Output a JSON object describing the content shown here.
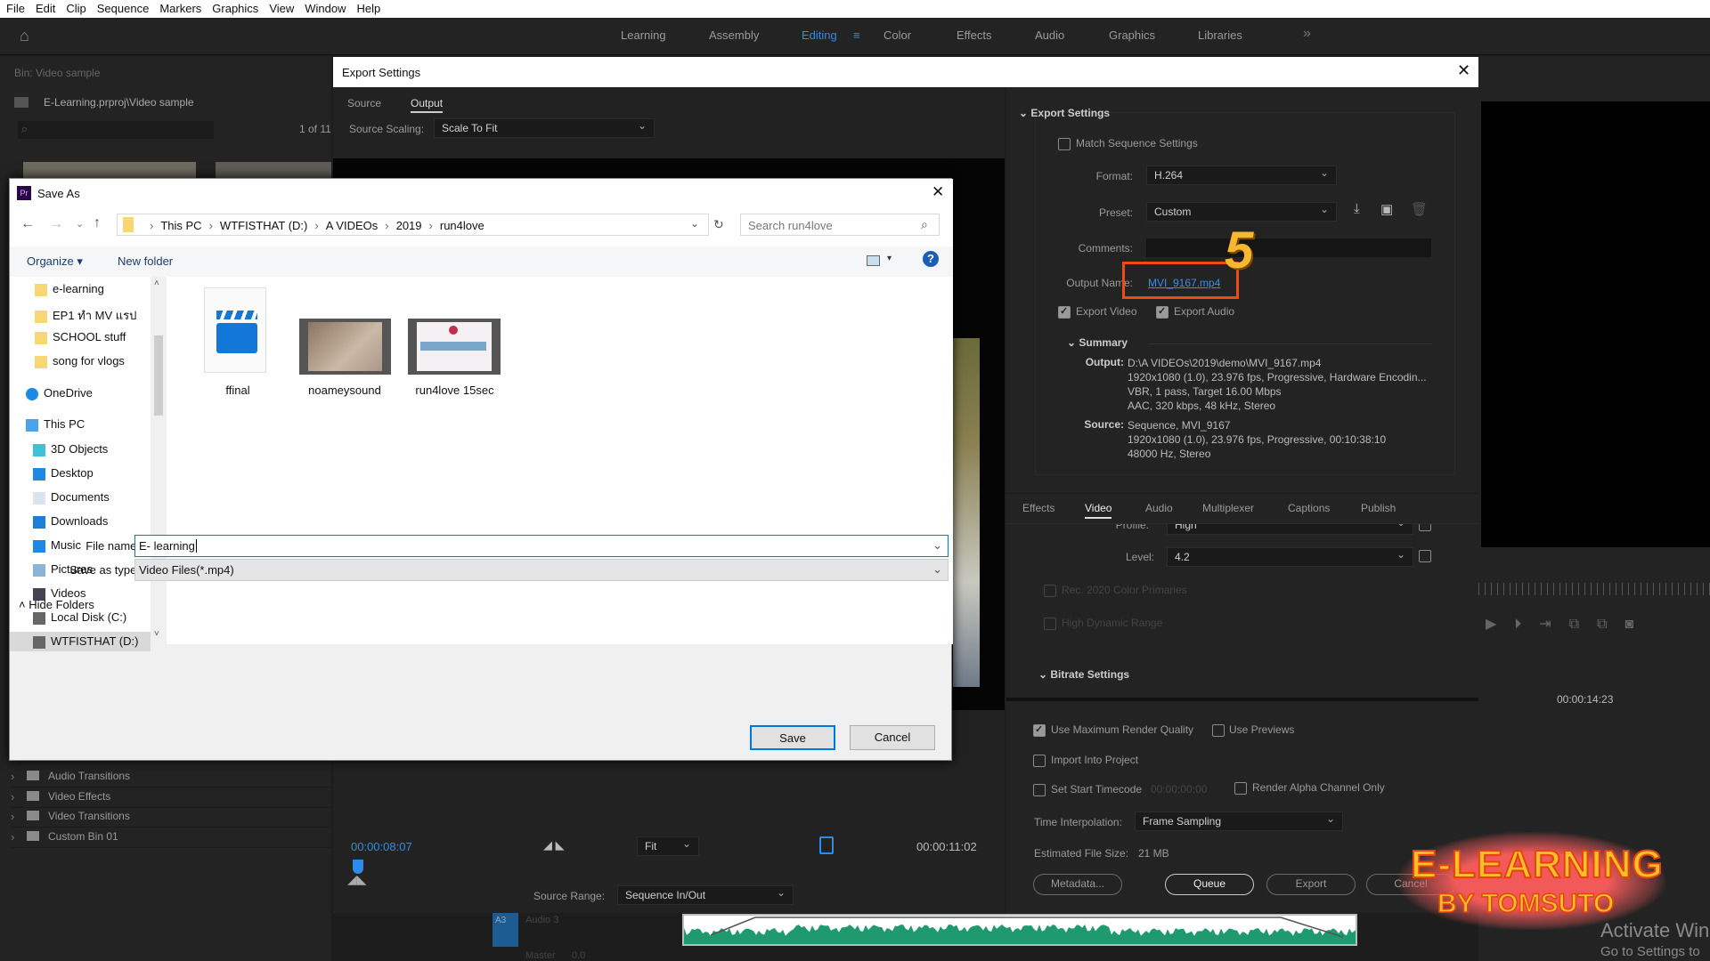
{
  "menu": [
    "File",
    "Edit",
    "Clip",
    "Sequence",
    "Markers",
    "Graphics",
    "View",
    "Window",
    "Help"
  ],
  "workspaces": [
    {
      "label": "Learning"
    },
    {
      "label": "Assembly"
    },
    {
      "label": "Editing",
      "active": true
    },
    {
      "label": "Color"
    },
    {
      "label": "Effects"
    },
    {
      "label": "Audio"
    },
    {
      "label": "Graphics"
    },
    {
      "label": "Libraries"
    }
  ],
  "accent": "#2d8ceb",
  "project": {
    "bin": "Bin: Video sample",
    "path": "E-Learning.prproj\\Video sample",
    "count": "1 of 11",
    "effects": [
      "Audio Transitions",
      "Video Effects",
      "Video Transitions",
      "Custom Bin 01"
    ]
  },
  "export": {
    "title": "Export Settings",
    "tabs": [
      "Source",
      "Output"
    ],
    "source_scaling_label": "Source Scaling:",
    "source_scaling": "Scale To Fit",
    "section": "Export Settings",
    "match_seq": "Match Sequence Settings",
    "format_label": "Format:",
    "format": "H.264",
    "preset_label": "Preset:",
    "preset": "Custom",
    "comments_label": "Comments:",
    "output_name_label": "Output Name:",
    "output_name": "MVI_9167.mp4",
    "annotation_number": "5",
    "export_video": "Export Video",
    "export_audio": "Export Audio",
    "summary": "Summary",
    "output_label": "Output:",
    "output_lines": [
      "D:\\A VIDEOs\\2019\\demo\\MVI_9167.mp4",
      "1920x1080 (1.0), 23.976 fps, Progressive, Hardware Encodin...",
      "VBR, 1 pass, Target 16.00 Mbps",
      "AAC, 320 kbps, 48 kHz, Stereo"
    ],
    "source_label": "Source:",
    "source_lines": [
      "Sequence, MVI_9167",
      "1920x1080 (1.0), 23.976 fps, Progressive, 00:10:38:10",
      "48000 Hz, Stereo"
    ],
    "settings_tabs": [
      "Effects",
      "Video",
      "Audio",
      "Multiplexer",
      "Captions",
      "Publish"
    ],
    "active_settings_tab": "Video",
    "profile_label": "Profile:",
    "profile": "High",
    "level_label": "Level:",
    "level": "4.2",
    "rec2020": "Rec. 2020 Color Primaries",
    "hdr": "High Dynamic Range",
    "bitrate": "Bitrate Settings",
    "max_quality": "Use Maximum Render Quality",
    "use_previews": "Use Previews",
    "import_project": "Import Into Project",
    "start_tc": "Set Start Timecode",
    "start_tc_value": "00:00:00:00",
    "alpha": "Render Alpha Channel Only",
    "interp_label": "Time Interpolation:",
    "interp": "Frame Sampling",
    "filesize_label": "Estimated File Size:",
    "filesize": "21 MB",
    "buttons": [
      "Metadata...",
      "Queue",
      "Export",
      "Cancel"
    ],
    "current_tc": "00:00:08:07",
    "fit": "Fit",
    "duration_tc": "00:00:11:02",
    "range_label": "Source Range:",
    "range": "Sequence In/Out"
  },
  "timeline": {
    "track": "A3",
    "track_name": "Audio 3",
    "master": "Master",
    "master_val": "0.0",
    "waveform_color": "#1f9a6e"
  },
  "program": {
    "timecode": "00:00:14:23"
  },
  "saveas": {
    "title": "Save As",
    "crumbs": [
      "This PC",
      "WTFISTHAT (D:)",
      "A VIDEOs",
      "2019",
      "run4love"
    ],
    "search_placeholder": "Search run4love",
    "organize": "Organize",
    "new_folder": "New folder",
    "nav": [
      {
        "label": "e-learning",
        "icon": "folder"
      },
      {
        "label": "EP1 ทำ MV แรป",
        "icon": "folder"
      },
      {
        "label": "SCHOOL stuff",
        "icon": "folder"
      },
      {
        "label": "song for vlogs",
        "icon": "folder"
      },
      {
        "label": "OneDrive",
        "icon": "cloud"
      },
      {
        "label": "This PC",
        "icon": "computer"
      },
      {
        "label": "3D Objects",
        "icon": "cube"
      },
      {
        "label": "Desktop",
        "icon": "desktop"
      },
      {
        "label": "Documents",
        "icon": "document"
      },
      {
        "label": "Downloads",
        "icon": "download"
      },
      {
        "label": "Music",
        "icon": "music"
      },
      {
        "label": "Pictures",
        "icon": "picture"
      },
      {
        "label": "Videos",
        "icon": "film"
      },
      {
        "label": "Local Disk (C:)",
        "icon": "drive"
      },
      {
        "label": "WTFISTHAT (D:)",
        "icon": "drive",
        "selected": true
      }
    ],
    "files": [
      "ffinal",
      "noameysound",
      "run4love 15sec"
    ],
    "filename_label": "File name:",
    "filename": "E- learning",
    "type_label": "Save as type:",
    "type": "Video Files(*.mp4)",
    "hide_folders": "Hide Folders",
    "save": "Save",
    "cancel": "Cancel"
  },
  "logo": {
    "line1": "E-LEARNING",
    "line2": "BY TOMSUTO"
  },
  "watermark": [
    "Activate Win",
    "Go to Settings to"
  ]
}
